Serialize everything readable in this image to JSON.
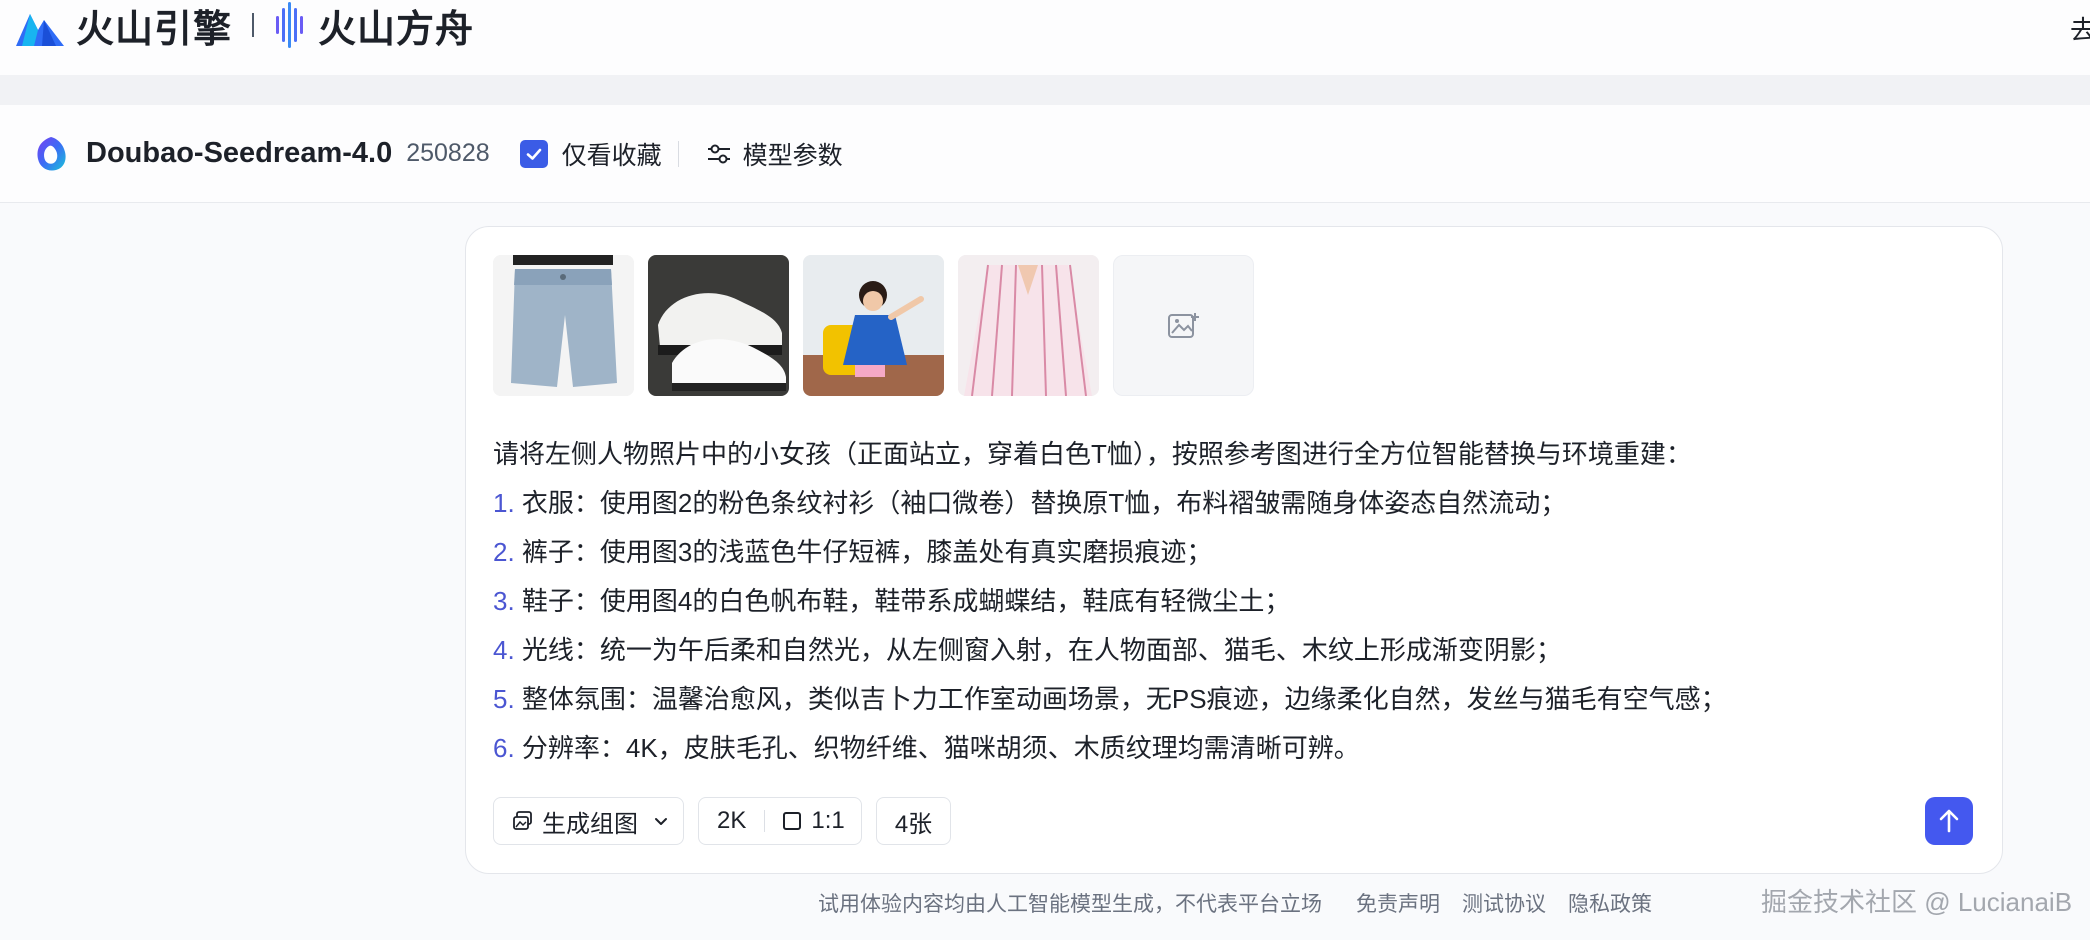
{
  "header": {
    "brand_primary": "火山引擎",
    "brand_secondary": "火山方舟",
    "right_text": "去"
  },
  "model_bar": {
    "model_name": "Doubao-Seedream-4.0",
    "model_version": "250828",
    "favorites_only_label": "仅看收藏",
    "favorites_only_checked": true,
    "model_params_label": "模型参数"
  },
  "reference_images": [
    {
      "icon": "denim-shorts-image"
    },
    {
      "icon": "white-sneakers-image"
    },
    {
      "icon": "girl-photo-image"
    },
    {
      "icon": "pink-striped-shirt-image"
    }
  ],
  "add_image_icon": "add-image-icon",
  "prompt": {
    "intro": "请将左侧人物照片中的小女孩（正面站立，穿着白色T恤），按照参考图进行全方位智能替换与环境重建：",
    "items": [
      {
        "num": "1.",
        "text": "衣服：使用图2的粉色条纹衬衫（袖口微卷）替换原T恤，布料褶皱需随身体姿态自然流动；"
      },
      {
        "num": "2.",
        "text": "裤子：使用图3的浅蓝色牛仔短裤，膝盖处有真实磨损痕迹；"
      },
      {
        "num": "3.",
        "text": "鞋子：使用图4的白色帆布鞋，鞋带系成蝴蝶结，鞋底有轻微尘土；"
      },
      {
        "num": "4.",
        "text": "光线：统一为午后柔和自然光，从左侧窗入射，在人物面部、猫毛、木纹上形成渐变阴影；"
      },
      {
        "num": "5.",
        "text": "整体氛围：温馨治愈风，类似吉卜力工作室动画场景，无PS痕迹，边缘柔化自然，发丝与猫毛有空气感；"
      },
      {
        "num": "6.",
        "text": "分辨率：4K，皮肤毛孔、织物纤维、猫咪胡须、木质纹理均需清晰可辨。"
      }
    ]
  },
  "controls": {
    "generate_mode": "生成组图",
    "resolution": "2K",
    "aspect_ratio": "1:1",
    "count": "4张"
  },
  "footer": {
    "disclaimer": "试用体验内容均由人工智能模型生成，不代表平台立场",
    "links": [
      "免责声明",
      "测试协议",
      "隐私政策"
    ],
    "watermark": "掘金技术社区 @ LucianaiB"
  },
  "colors": {
    "accent": "#4458ef",
    "checkbox": "#3b5ce6",
    "list_number": "#4b56d2"
  }
}
